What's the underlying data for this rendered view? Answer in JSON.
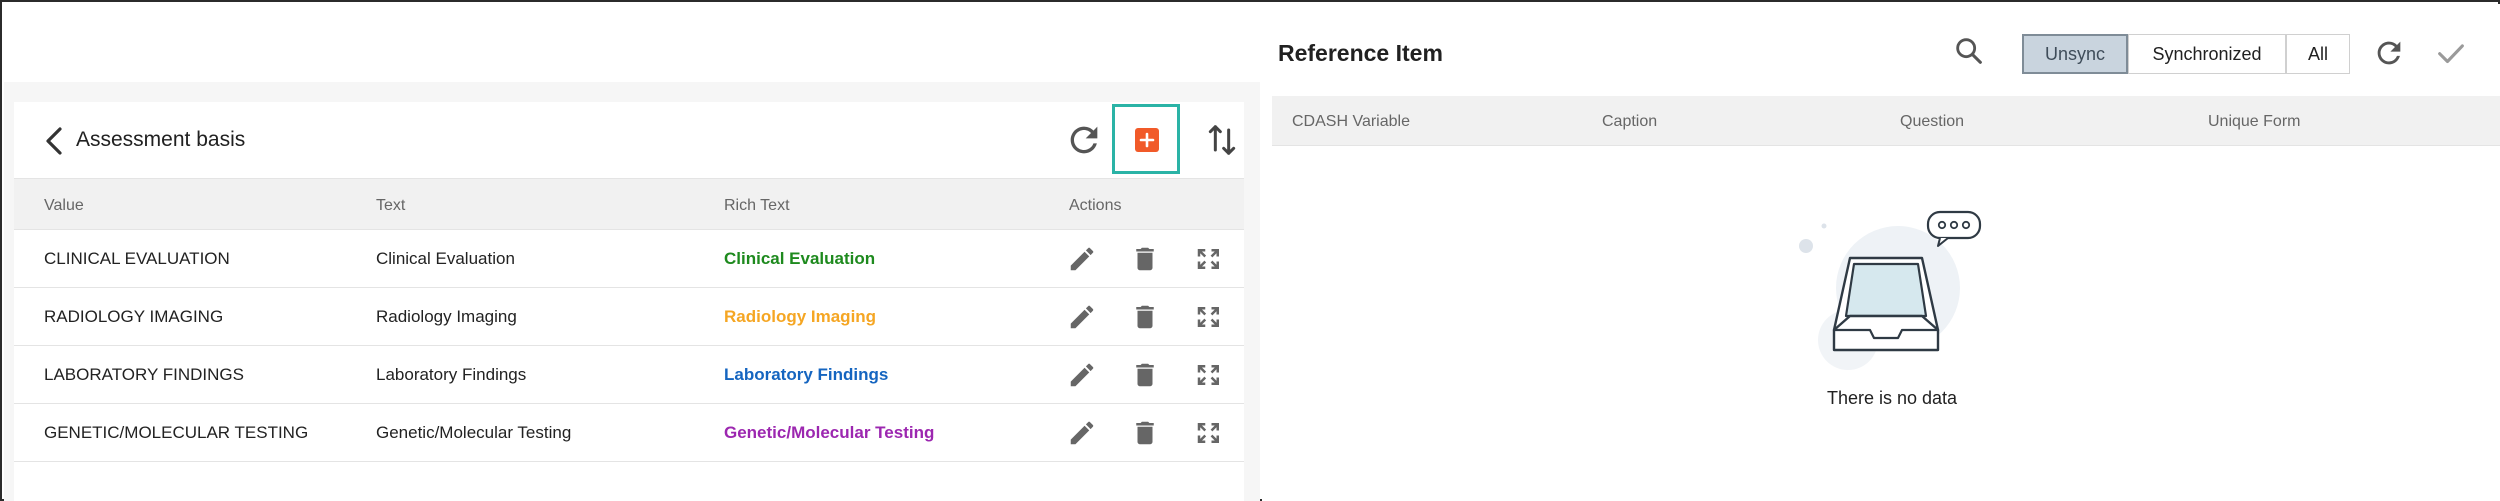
{
  "left_panel": {
    "title": "Assessment basis",
    "columns": [
      "Value",
      "Text",
      "Rich Text",
      "Actions"
    ],
    "rows": [
      {
        "value": "CLINICAL EVALUATION",
        "text": "Clinical Evaluation",
        "rich": "Clinical Evaluation",
        "color": "#1e8a1e"
      },
      {
        "value": "RADIOLOGY IMAGING",
        "text": "Radiology Imaging",
        "rich": "Radiology Imaging",
        "color": "#f5a623"
      },
      {
        "value": "LABORATORY FINDINGS",
        "text": "Laboratory Findings",
        "rich": "Laboratory Findings",
        "color": "#1565c0"
      },
      {
        "value": "GENETIC/MOLECULAR TESTING",
        "text": "Genetic/Molecular Testing",
        "rich": "Genetic/Molecular Testing",
        "color": "#9c27b0"
      }
    ],
    "icons": {
      "back": "arrow-left-icon",
      "refresh": "refresh-icon",
      "add": "add-box-icon",
      "sort": "sort-arrows-icon",
      "edit": "pencil-icon",
      "delete": "trash-icon",
      "expand": "expand-icon"
    },
    "accent_add": "#f15a29",
    "highlight_border": "#2ab3a6"
  },
  "right_panel": {
    "title": "Reference Item",
    "filters": {
      "unsync": "Unsync",
      "synchronized": "Synchronized",
      "all": "All",
      "selected": "Unsync"
    },
    "columns": [
      "CDASH Variable",
      "Caption",
      "Question",
      "Unique Form"
    ],
    "empty_message": "There is no data",
    "icons": {
      "search": "search-icon",
      "refresh": "refresh-icon",
      "confirm": "check-icon",
      "empty": "empty-inbox-icon"
    }
  }
}
